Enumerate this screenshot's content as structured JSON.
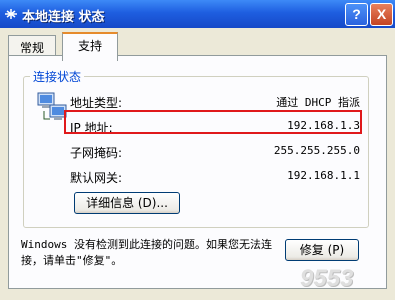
{
  "window": {
    "title": "本地连接 状态",
    "help": "?",
    "close": "X"
  },
  "tabs": [
    {
      "label": "常规"
    },
    {
      "label": "支持"
    }
  ],
  "status": {
    "group_title": "连接状态",
    "rows": [
      {
        "label": "地址类型:",
        "value": "通过 DHCP 指派"
      },
      {
        "label": "IP 地址:",
        "value": "192.168.1.3"
      },
      {
        "label": "子网掩码:",
        "value": "255.255.255.0"
      },
      {
        "label": "默认网关:",
        "value": "192.168.1.1"
      }
    ],
    "details_button": "详细信息 (D)..."
  },
  "message": "Windows 没有检测到此连接的问题。如果您无法连接，请单击\"修复\"。",
  "repair_button": "修复 (P)",
  "watermark": "9553"
}
